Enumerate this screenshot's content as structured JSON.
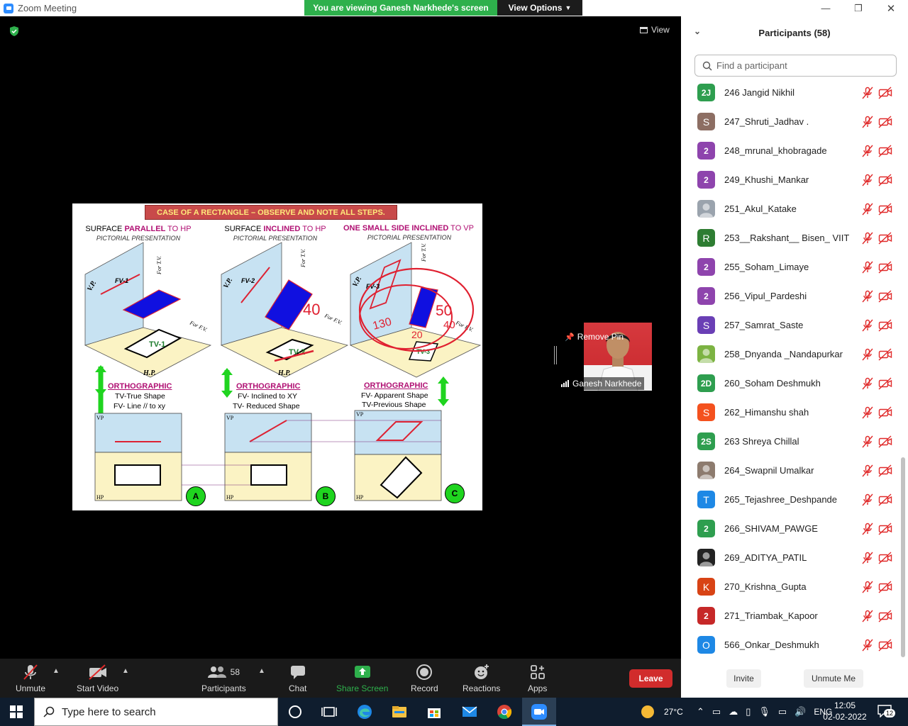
{
  "window": {
    "title": "Zoom Meeting",
    "banner_text": "You are viewing Ganesh Narkhede's screen",
    "view_options_label": "View Options",
    "minimize": "—",
    "maximize": "❐",
    "close": "✕"
  },
  "stage": {
    "view_label": "View",
    "slide": {
      "title": "CASE OF A RECTANGLE – OBSERVE AND NOTE ALL STEPS.",
      "columns": [
        {
          "pre": "SURFACE ",
          "hl": "PARALLEL",
          "post": " TO HP",
          "sub": "PICTORIAL PRESENTATION",
          "ortho": "ORTHOGRAPHIC",
          "note1": "TV-True Shape",
          "note2": "FV- Line // to xy",
          "label": "A"
        },
        {
          "pre": "SURFACE ",
          "hl": "INCLINED",
          "post": " TO HP",
          "sub": "PICTORIAL PRESENTATION",
          "ortho": "ORTHOGRAPHIC",
          "note1": "FV- Inclined to XY",
          "note2": "TV- Reduced Shape",
          "label": "B"
        },
        {
          "pre": "",
          "hl": "ONE SMALL SIDE INCLINED",
          "post": " TO VP",
          "sub": "PICTORIAL PRESENTATION",
          "ortho": "ORTHOGRAPHIC",
          "note1": "FV- Apparent Shape",
          "note2": "TV-Previous Shape",
          "label": "C"
        }
      ],
      "handwritten": [
        "40",
        "130",
        "20",
        "50",
        "40"
      ],
      "drawing_labels": {
        "vp": "V.P.",
        "hp": "H.P.",
        "fv1": "FV-1",
        "fv2": "FV-2",
        "fv3": "FV-3",
        "tv1": "TV-1",
        "tv2": "TV-2",
        "tv3": "TV-3",
        "for_tv": "For T.V.",
        "for_fv": "For F.V.",
        "vp_small": "VP",
        "hp_small": "HP"
      }
    },
    "pinned": {
      "remove_pin_label": "Remove Pin",
      "name": "Ganesh Narkhede"
    }
  },
  "toolbar": {
    "unmute": "Unmute",
    "start_video": "Start Video",
    "participants": "Participants",
    "participants_count": "58",
    "chat": "Chat",
    "share_screen": "Share Screen",
    "record": "Record",
    "reactions": "Reactions",
    "apps": "Apps",
    "leave": "Leave"
  },
  "panel": {
    "title": "Participants (58)",
    "search_placeholder": "Find a participant",
    "invite": "Invite",
    "unmute_me": "Unmute Me",
    "participants": [
      {
        "avatar": "2J",
        "color": "#2e9e4f",
        "name": "246 Jangid Nikhil"
      },
      {
        "avatar": "S",
        "color": "#8d6e63",
        "name": "247_Shruti_Jadhav ."
      },
      {
        "avatar": "2",
        "color": "#8e44ad",
        "name": "248_mrunal_khobragade"
      },
      {
        "avatar": "2",
        "color": "#8e44ad",
        "name": "249_Khushi_Mankar"
      },
      {
        "avatar": "photo",
        "color": "#9aa3ad",
        "name": "251_Akul_Katake"
      },
      {
        "avatar": "R",
        "color": "#2e7d32",
        "name": "253__Rakshant__ Bisen_ VIIT"
      },
      {
        "avatar": "2",
        "color": "#8e44ad",
        "name": "255_Soham_Limaye"
      },
      {
        "avatar": "2",
        "color": "#8e44ad",
        "name": "256_Vipul_Pardeshi"
      },
      {
        "avatar": "S",
        "color": "#6a3fb5",
        "name": "257_Samrat_Saste"
      },
      {
        "avatar": "photo",
        "color": "#7cb342",
        "name": "258_Dnyanda _Nandapurkar"
      },
      {
        "avatar": "2D",
        "color": "#2e9e4f",
        "name": "260_Soham Deshmukh"
      },
      {
        "avatar": "S",
        "color": "#f4511e",
        "name": "262_Himanshu shah"
      },
      {
        "avatar": "2S",
        "color": "#2e9e4f",
        "name": "263 Shreya Chillal"
      },
      {
        "avatar": "photo",
        "color": "#8d7b6e",
        "name": "264_Swapnil Umalkar"
      },
      {
        "avatar": "T",
        "color": "#1e88e5",
        "name": "265_Tejashree_Deshpande"
      },
      {
        "avatar": "2",
        "color": "#2e9e4f",
        "name": "266_SHIVAM_PAWGE"
      },
      {
        "avatar": "photo",
        "color": "#222222",
        "name": "269_ADITYA_PATIL"
      },
      {
        "avatar": "K",
        "color": "#d84315",
        "name": "270_Krishna_Gupta"
      },
      {
        "avatar": "2",
        "color": "#c62828",
        "name": "271_Triambak_Kapoor"
      },
      {
        "avatar": "O",
        "color": "#1e88e5",
        "name": "566_Onkar_Deshmukh"
      }
    ]
  },
  "taskbar": {
    "search_placeholder": "Type here to search",
    "temperature": "27°C",
    "language": "ENG",
    "time": "12:05",
    "date": "02-02-2022",
    "notifications": "12"
  }
}
